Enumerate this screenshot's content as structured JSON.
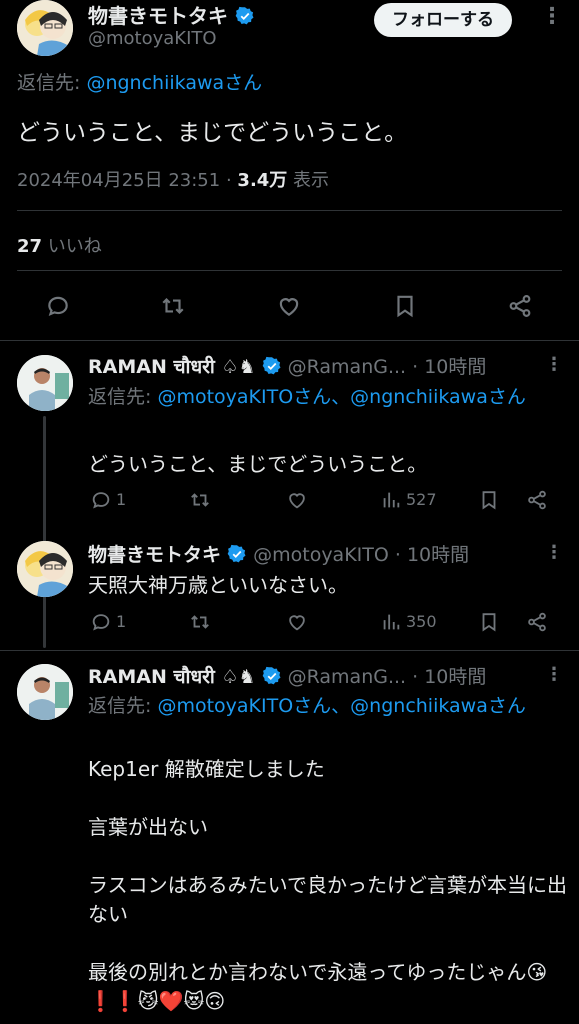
{
  "main_tweet": {
    "author_name": "物書きモトタキ",
    "handle": "@motoyaKITO",
    "follow_label": "フォローする",
    "reply_prefix": "返信先: ",
    "reply_target": "@ngnchiikawaさん",
    "text": "どういうこと、まじでどういうこと。",
    "timestamp": "2024年04月25日 23:51",
    "sep": "·",
    "views_count": "3.4万",
    "views_label": "表示",
    "likes_count": "27",
    "likes_label": "いいね"
  },
  "replies": [
    {
      "author_name": "RAMAN चौधरी ♤♞",
      "handle": "@RamanG...",
      "time": "· 10時間",
      "reply_prefix": "返信先: ",
      "reply_targets": "@motoyaKITOさん、@ngnchiikawaさん",
      "text": "どういうこと、まじでどういうこと。",
      "reply_count": "1",
      "retweet_count": "",
      "like_count": "",
      "views": "527"
    },
    {
      "author_name": "物書きモトタキ",
      "handle": "@motoyaKITO",
      "time": "· 10時間",
      "text": "天照大神万歳といいなさい。",
      "reply_count": "1",
      "views": "350"
    },
    {
      "author_name": "RAMAN चौधरी ♤♞",
      "handle": "@RamanG...",
      "time": "· 10時間",
      "reply_prefix": "返信先: ",
      "reply_targets": "@motoyaKITOさん、@ngnchiikawaさん",
      "line1": "Kep1er 解散確定しました",
      "line2": "言葉が出ない",
      "line3": "ラスコンはあるみたいで良かったけど言葉が本当に出ない",
      "line4": "最後の別れとか言わないで永遠ってゆったじゃん",
      "emojis": "😘❗❗😼❤️😻🙃"
    }
  ],
  "colors": {
    "background": "#000000",
    "text": "#e7e9ea",
    "muted": "#71767b",
    "link": "#1d9bf0",
    "verified": "#1d9bf0"
  }
}
